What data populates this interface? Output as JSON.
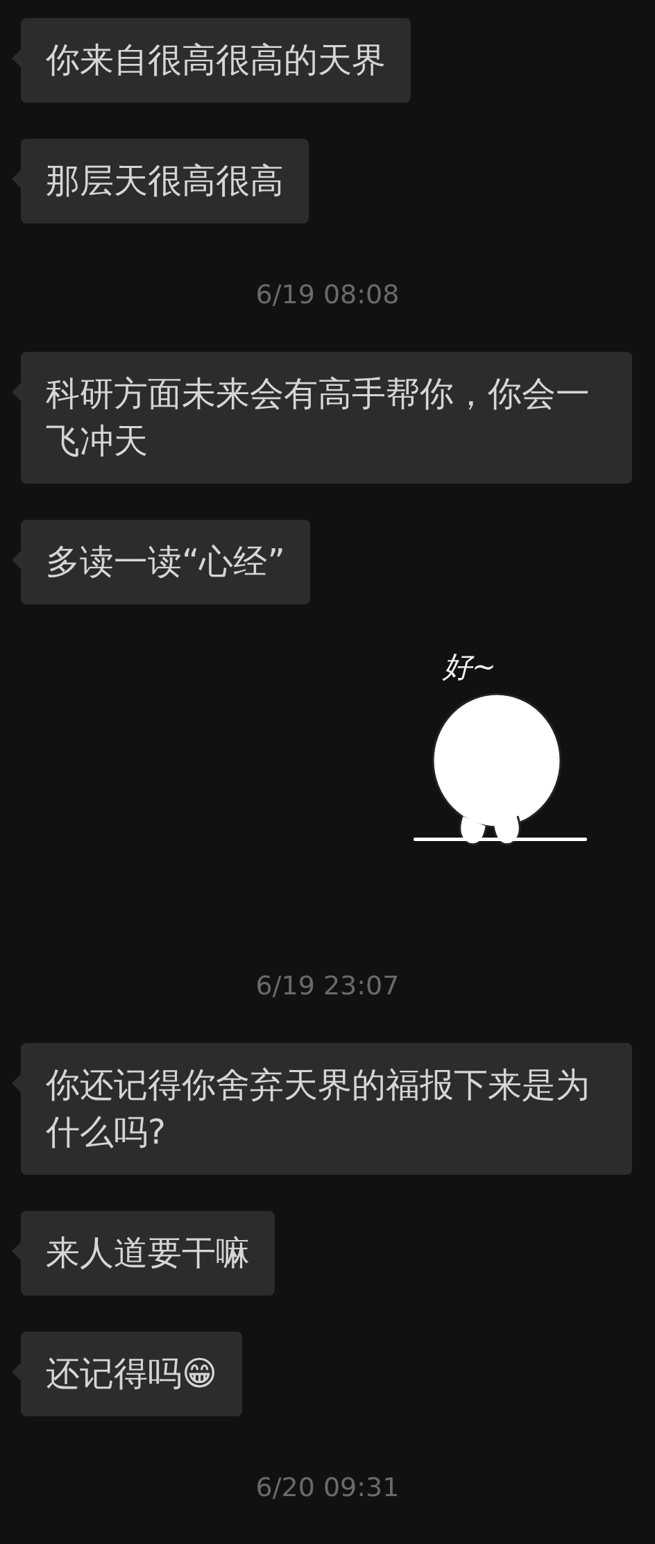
{
  "messages": [
    {
      "kind": "bubble",
      "text": "你来自很高很高的天界"
    },
    {
      "kind": "bubble",
      "text": "那层天很高很高"
    },
    {
      "kind": "timestamp",
      "text": "6/19 08:08"
    },
    {
      "kind": "bubble",
      "text": "科研方面未来会有高手帮你，你会一飞冲天"
    },
    {
      "kind": "bubble",
      "text": "多读一读“心经”"
    },
    {
      "kind": "sticker",
      "caption": "好~"
    },
    {
      "kind": "timestamp",
      "text": "6/19 23:07"
    },
    {
      "kind": "bubble",
      "text": "你还记得你舍弃天界的福报下来是为什么吗?"
    },
    {
      "kind": "bubble",
      "text": "来人道要干嘛"
    },
    {
      "kind": "bubble",
      "text": "还记得吗😁"
    },
    {
      "kind": "timestamp",
      "text": "6/20 09:31"
    }
  ]
}
